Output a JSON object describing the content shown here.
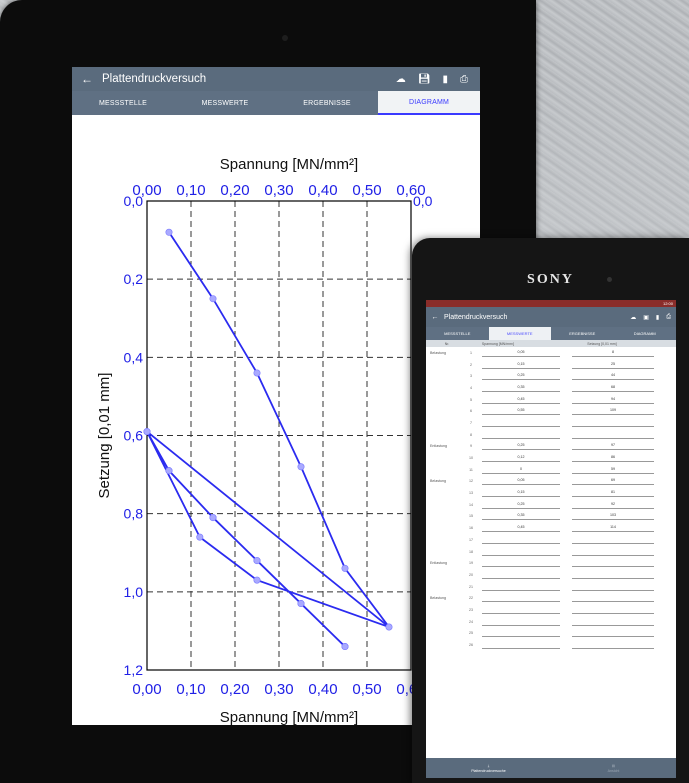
{
  "app": {
    "title": "Plattendruckversuch",
    "actions": [
      "cloud-upload-icon",
      "save-icon",
      "delete-icon",
      "print-icon"
    ]
  },
  "tablet": {
    "tabs": [
      "MESSSTELLE",
      "MESSWERTE",
      "ERGEBNISSE",
      "DIAGRAMM"
    ],
    "active_tab": "DIAGRAMM"
  },
  "chart_data": {
    "type": "line",
    "xlabel_top": "Spannung [MN/mm²]",
    "xlabel_bottom": "Spannung [MN/mm²]",
    "ylabel": "Setzung [0,01 mm]",
    "x_ticks": [
      "0,00",
      "0,10",
      "0,20",
      "0,30",
      "0,40",
      "0,50",
      "0,60"
    ],
    "y_ticks": [
      "0,0",
      "0,2",
      "0,4",
      "0,6",
      "0,8",
      "1,0",
      "1,2"
    ],
    "right_tick": "0,0",
    "xlim": [
      0,
      0.6
    ],
    "ylim": [
      0,
      1.2
    ],
    "grid": "vertical dashed + horizontal dashed",
    "line_color": "#2b2bf0",
    "x": [
      0.05,
      0.15,
      0.25,
      0.35,
      0.45,
      0.55,
      0.25,
      0.12,
      0.0,
      0.05,
      0.15,
      0.25,
      0.35,
      0.45,
      0.0,
      0.05,
      0.15,
      0.25,
      0.35,
      0.45
    ],
    "y": [
      0.08,
      0.25,
      0.44,
      0.68,
      0.94,
      1.09,
      0.97,
      0.86,
      0.59,
      0.69,
      0.81,
      0.92,
      1.03,
      1.14,
      0.59,
      0.69,
      0.81,
      0.92,
      1.03,
      1.14
    ],
    "series": [
      {
        "x": [
          0.05,
          0.15,
          0.25,
          0.35,
          0.45,
          0.55,
          0.25,
          0.12,
          0.0,
          0.05,
          0.15,
          0.25,
          0.35,
          0.45
        ],
        "y": [
          0.08,
          0.25,
          0.44,
          0.68,
          0.94,
          1.09,
          0.97,
          0.86,
          0.59,
          0.69,
          0.81,
          0.92,
          1.03,
          1.14
        ]
      },
      {
        "x": [
          0.0,
          0.55
        ],
        "y": [
          0.59,
          1.09
        ]
      }
    ]
  },
  "phone": {
    "brand": "SONY",
    "status_time": "12:00",
    "tabs": [
      "MESSSTELLE",
      "MESSWERTE",
      "ERGEBNISSE",
      "DIAGRAMM"
    ],
    "active_tab": "MESSWERTE",
    "table_headers": [
      "Nr.",
      "Spannung [MN/mm²]",
      "Setzung [0,01 mm]"
    ],
    "rows": [
      {
        "phase": "Belastung",
        "n": "1",
        "s": "0,05",
        "z": "8"
      },
      {
        "phase": "",
        "n": "2",
        "s": "0,15",
        "z": "25"
      },
      {
        "phase": "",
        "n": "3",
        "s": "0,25",
        "z": "44"
      },
      {
        "phase": "",
        "n": "4",
        "s": "0,35",
        "z": "68"
      },
      {
        "phase": "",
        "n": "5",
        "s": "0,45",
        "z": "94"
      },
      {
        "phase": "",
        "n": "6",
        "s": "0,55",
        "z": "109"
      },
      {
        "phase": "",
        "n": "7",
        "s": "",
        "z": ""
      },
      {
        "phase": "",
        "n": "8",
        "s": "",
        "z": ""
      },
      {
        "phase": "Entlastung",
        "n": "9",
        "s": "0,25",
        "z": "97"
      },
      {
        "phase": "",
        "n": "10",
        "s": "0,12",
        "z": "86"
      },
      {
        "phase": "",
        "n": "11",
        "s": "0",
        "z": "59"
      },
      {
        "phase": "Belastung",
        "n": "12",
        "s": "0,05",
        "z": "69"
      },
      {
        "phase": "",
        "n": "13",
        "s": "0,15",
        "z": "81"
      },
      {
        "phase": "",
        "n": "14",
        "s": "0,25",
        "z": "92"
      },
      {
        "phase": "",
        "n": "15",
        "s": "0,35",
        "z": "103"
      },
      {
        "phase": "",
        "n": "16",
        "s": "0,45",
        "z": "114"
      },
      {
        "phase": "",
        "n": "17",
        "s": "",
        "z": ""
      },
      {
        "phase": "",
        "n": "18",
        "s": "",
        "z": ""
      },
      {
        "phase": "Entlastung",
        "n": "19",
        "s": "",
        "z": ""
      },
      {
        "phase": "",
        "n": "20",
        "s": "",
        "z": ""
      },
      {
        "phase": "",
        "n": "21",
        "s": "",
        "z": ""
      },
      {
        "phase": "Belastung",
        "n": "22",
        "s": "",
        "z": ""
      },
      {
        "phase": "",
        "n": "23",
        "s": "",
        "z": ""
      },
      {
        "phase": "",
        "n": "24",
        "s": "",
        "z": ""
      },
      {
        "phase": "",
        "n": "25",
        "s": "",
        "z": ""
      },
      {
        "phase": "",
        "n": "26",
        "s": "",
        "z": ""
      }
    ],
    "nav": [
      {
        "label": "Plattendruckversuche",
        "icon": "download-icon"
      },
      {
        "label": "Ansicht",
        "icon": "sheet-icon"
      }
    ]
  }
}
